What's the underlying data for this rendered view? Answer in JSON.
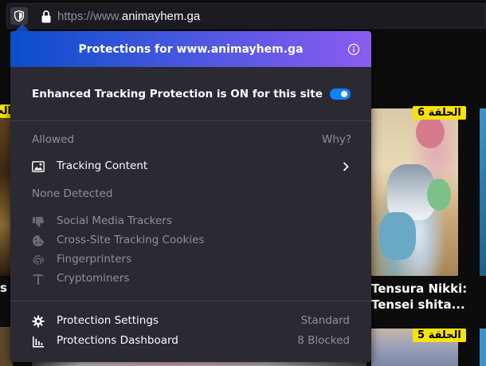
{
  "urlbar": {
    "url_prefix": "https://www.",
    "url_domain": "animayhem.ga"
  },
  "background": {
    "badge_left": "الحلقة",
    "badge_episode_6": "الحلقة 6",
    "badge_episode_5": "الحلقة 5",
    "title_line1": "Tensura Nikki:",
    "title_line2": "Tensei shita...",
    "title_left_fragment": "s F"
  },
  "panel": {
    "title": "Protections for www.animayhem.ga",
    "etp_label": "Enhanced Tracking Protection is ON for this site",
    "etp_enabled": true,
    "allowed_label": "Allowed",
    "why_label": "Why?",
    "allowed_items": [
      {
        "label": "Tracking Content",
        "icon": "image-icon"
      }
    ],
    "none_detected_label": "None Detected",
    "none_detected_items": [
      {
        "label": "Social Media Trackers",
        "icon": "thumbs-down-icon"
      },
      {
        "label": "Cross-Site Tracking Cookies",
        "icon": "cookie-icon"
      },
      {
        "label": "Fingerprinters",
        "icon": "fingerprint-icon"
      },
      {
        "label": "Cryptominers",
        "icon": "pickaxe-icon"
      }
    ],
    "footer": [
      {
        "label": "Protection Settings",
        "value": "Standard",
        "icon": "gear-icon"
      },
      {
        "label": "Protections Dashboard",
        "value": "8 Blocked",
        "icon": "bar-chart-icon"
      }
    ]
  },
  "colors": {
    "panel_bg": "#2b2a33",
    "header_gradient_start": "#0a4ec9",
    "header_gradient_end": "#8a5cf0",
    "toggle_on": "#0a84ff",
    "muted_text": "#8f8f9d",
    "badge_yellow": "#f6e30c"
  }
}
